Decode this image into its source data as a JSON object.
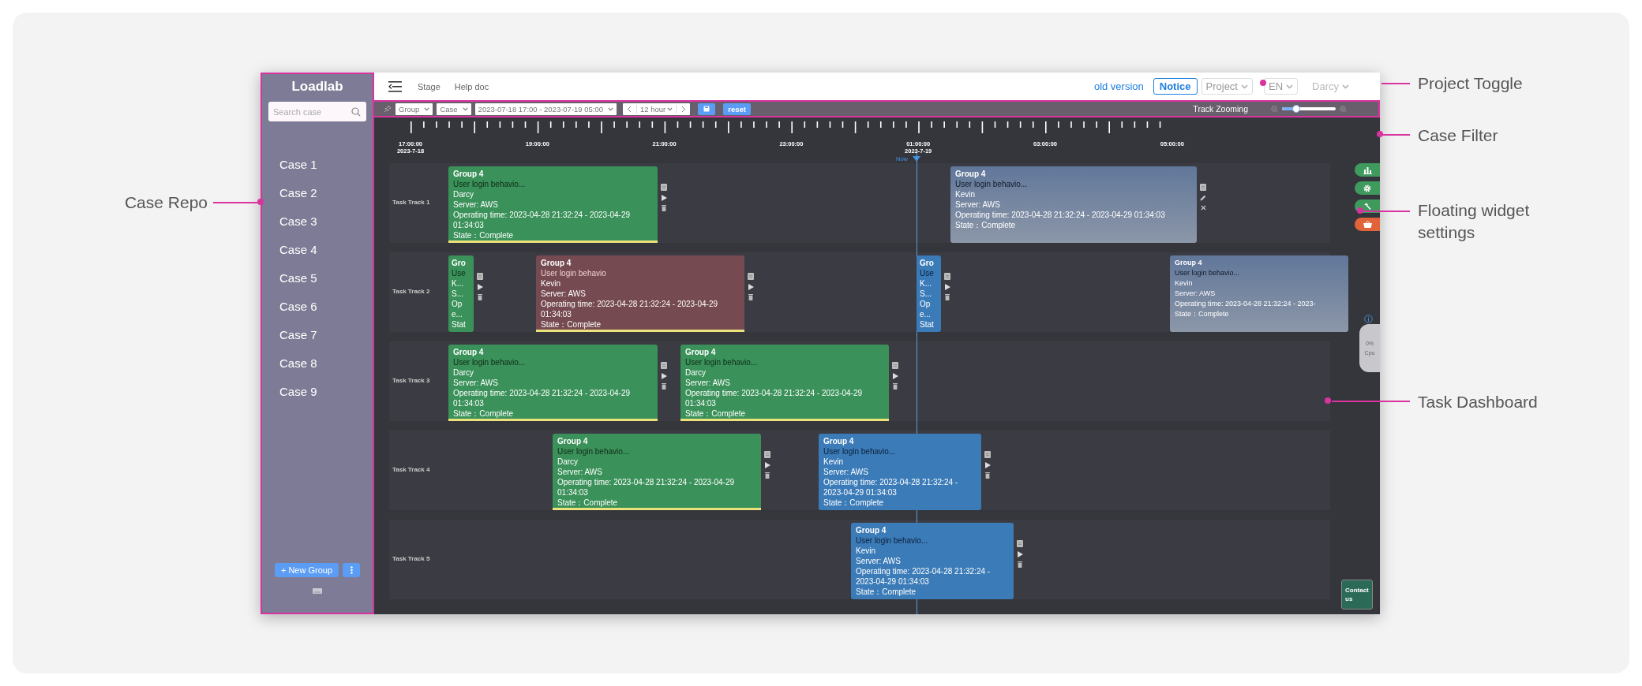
{
  "sidebar": {
    "logo": "Loadlab",
    "search": {
      "placeholder": "Search case"
    },
    "cases": [
      {
        "label": "Case 1"
      },
      {
        "label": "Case 2"
      },
      {
        "label": "Case 3"
      },
      {
        "label": "Case 4"
      },
      {
        "label": "Case 5"
      },
      {
        "label": "Case 6"
      },
      {
        "label": "Case 7"
      },
      {
        "label": "Case 8"
      },
      {
        "label": "Case 9"
      }
    ],
    "new_group": "+ New Group"
  },
  "topbar": {
    "nav": [
      "Stage",
      "Help doc"
    ],
    "old_version": "old version",
    "notice": "Notice",
    "selects": [
      "Project",
      "EN",
      "Darcy"
    ]
  },
  "filter_bar": {
    "selects": [
      "Group",
      "Case",
      "2023-07-18 17:00 - 2023-07-19 05:00"
    ],
    "step": "12 hour",
    "reset": "reset",
    "zoom_label": "Track Zooming",
    "zoom": {
      "level": 0.27
    }
  },
  "ruler": {
    "labels": [
      {
        "time": "17:00:00",
        "date": "2023-7-18"
      },
      {
        "time": "19:00:00"
      },
      {
        "time": "21:00:00"
      },
      {
        "time": "23:00:00"
      },
      {
        "time": "01:00:00",
        "date": "2023-7-19"
      },
      {
        "time": "03:00:00"
      },
      {
        "time": "05:00:00"
      }
    ],
    "now": "Now"
  },
  "tracks": [
    {
      "label": "Task Track 1",
      "tasks": [
        {
          "kind": "run",
          "title": "Group 4",
          "subtitle": "User login behavio...",
          "lines": [
            "Darcy",
            "Server: AWS",
            "Operating time: 2023-04-28 21:32:24 - 2023-04-29 01:34:03",
            "State：Complete"
          ],
          "color": "#3a9159",
          "flagged": true
        },
        {
          "kind": "edit",
          "title": "Group 4",
          "subtitle": "User login behavio...",
          "lines": [
            "Kevin",
            "Server: AWS",
            "Operating time: 2023-04-28 21:32:24 - 2023-04-29 01:34:03",
            "State：Complete"
          ],
          "color": "#61779a",
          "flagged": false
        }
      ]
    },
    {
      "label": "Task Track 2",
      "tasks": [
        {
          "kind": "run",
          "title": "Gro",
          "subtitle": "Use",
          "lines": [
            "K...",
            "S...",
            "Op",
            "e...",
            "Stat"
          ],
          "color": "#3a9159",
          "flagged": false
        },
        {
          "kind": "run",
          "title": "Group 4",
          "subtitle": "User login behavio",
          "lines": [
            "Kevin",
            "Server: AWS",
            "Operating time: 2023-04-28 21:32:24 - 2023-04-29 01:34:03",
            "State：Complete"
          ],
          "color": "#754a50",
          "flagged": true
        },
        {
          "kind": "run",
          "title": "Gro",
          "subtitle": "Use",
          "lines": [
            "K...",
            "S...",
            "Op",
            "e...",
            "Stat"
          ],
          "color": "#3b7bb8",
          "flagged": false
        },
        {
          "kind": "plain",
          "title": "Group 4",
          "subtitle": "User login behavio...",
          "lines": [
            "Kevin",
            "Server: AWS",
            "Operating time: 2023-04-28 21:32:24 - 2023-",
            "State：Complete"
          ],
          "color": "#61779a",
          "flagged": false
        }
      ]
    },
    {
      "label": "Task Track 3",
      "tasks": [
        {
          "kind": "run",
          "title": "Group 4",
          "subtitle": "User login behavio...",
          "lines": [
            "Darcy",
            "Server: AWS",
            "Operating time: 2023-04-28 21:32:24 - 2023-04-29 01:34:03",
            "State：Complete"
          ],
          "color": "#3a9159",
          "flagged": true
        },
        {
          "kind": "run",
          "title": "Group 4",
          "subtitle": "User login behavio...",
          "lines": [
            "Darcy",
            "Server: AWS",
            "Operating time: 2023-04-28 21:32:24 - 2023-04-29 01:34:03",
            "State：Complete"
          ],
          "color": "#3a9159",
          "flagged": true
        }
      ]
    },
    {
      "label": "Task Track 4",
      "tasks": [
        {
          "kind": "run",
          "title": "Group 4",
          "subtitle": "User login behavio...",
          "lines": [
            "Darcy",
            "Server: AWS",
            "Operating time: 2023-04-28 21:32:24 - 2023-04-29 01:34:03",
            "State：Complete"
          ],
          "color": "#3a9159",
          "flagged": true
        },
        {
          "kind": "run",
          "title": "Group 4",
          "subtitle": "User login behavio...",
          "lines": [
            "Kevin",
            "Server: AWS",
            "Operating time: 2023-04-28 21:32:24 - 2023-04-29 01:34:03",
            "State：Complete"
          ],
          "color": "#3b7bb8",
          "flagged": false
        }
      ]
    },
    {
      "label": "Task Track 5",
      "tasks": [
        {
          "kind": "run",
          "title": "Group 4",
          "subtitle": "User login behavio...",
          "lines": [
            "Kevin",
            "Server: AWS",
            "Operating time: 2023-04-28 21:32:24 - 2023-04-29 01:34:03",
            "State：Complete"
          ],
          "color": "#3b7bb8",
          "flagged": false
        }
      ]
    }
  ],
  "widgets": {
    "cpu": {
      "value": "0%",
      "label": "Cpu"
    },
    "contact": "Contact us"
  },
  "annotations": [
    {
      "label": "Project Toggle"
    },
    {
      "label": "Case Filter"
    },
    {
      "label": "Case Repo"
    },
    {
      "label": "Floating widget settings"
    },
    {
      "label": "Task Dashboard"
    }
  ]
}
